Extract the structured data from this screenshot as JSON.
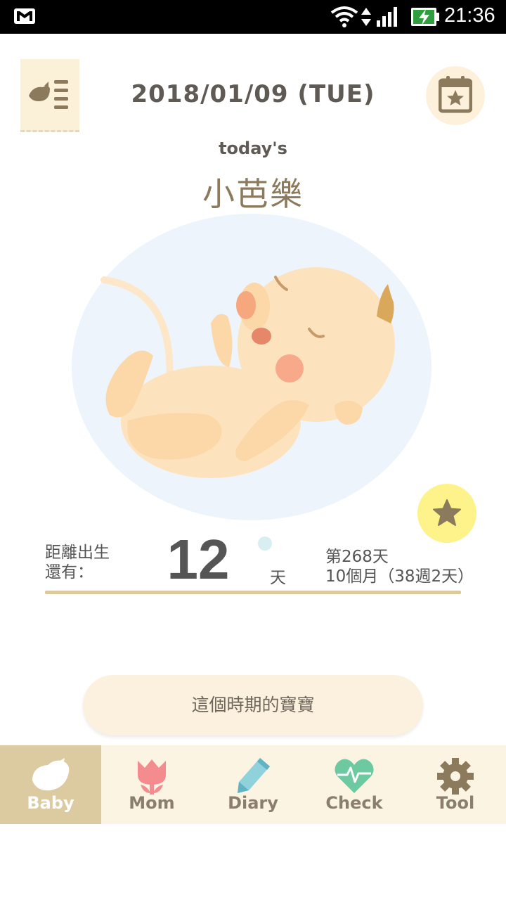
{
  "status_bar": {
    "time": "21:36",
    "icons": [
      "gmail-icon",
      "wifi-icon",
      "data-arrows-icon",
      "signal-icon",
      "battery-charging-icon"
    ]
  },
  "header": {
    "menu_icon": "bird-list-icon",
    "date": "2018/01/09 (TUE)",
    "calendar_icon": "calendar-star-icon"
  },
  "today": {
    "label": "today's",
    "name": "小芭樂"
  },
  "countdown": {
    "label_line1": "距離出生",
    "label_line2": "還有：",
    "days_left": "12",
    "unit": "天",
    "day_count": "第268天",
    "week_count": "10個月（38週2天）"
  },
  "period_button": {
    "label": "這個時期的寶寶"
  },
  "bottom_nav": {
    "items": [
      {
        "label": "Baby",
        "icon": "bird-icon",
        "active": true
      },
      {
        "label": "Mom",
        "icon": "tulip-icon",
        "active": false
      },
      {
        "label": "Diary",
        "icon": "pencil-icon",
        "active": false
      },
      {
        "label": "Check",
        "icon": "heartbeat-icon",
        "active": false
      },
      {
        "label": "Tool",
        "icon": "gear-icon",
        "active": false
      }
    ]
  },
  "colors": {
    "accent": "#dccba0",
    "nav_bg": "#fcf4e3",
    "favorite": "#fdf38a",
    "icon_brown": "#8b7a5c"
  }
}
